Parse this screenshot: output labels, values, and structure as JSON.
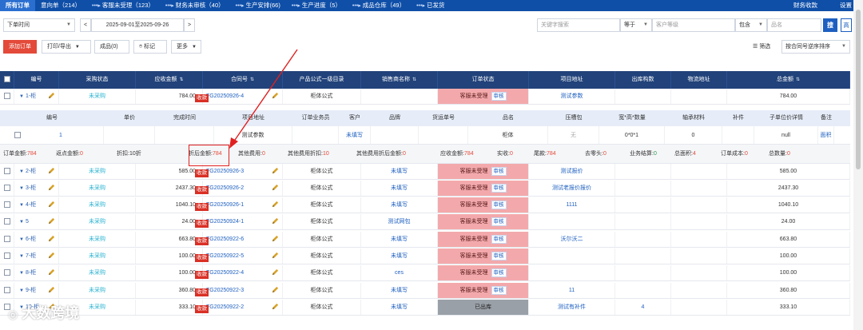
{
  "nav": {
    "tabs": [
      {
        "label": "所有订单"
      },
      {
        "label": "意向单（214）"
      },
      {
        "label": "客服未受理（123）"
      },
      {
        "label": "财务未审核（40）"
      },
      {
        "label": "生产安排(66)"
      },
      {
        "label": "生产进度（5）"
      },
      {
        "label": "成品仓库（49）"
      },
      {
        "label": "已发货"
      }
    ],
    "arrow": "•••▸",
    "right": [
      {
        "label": "财务收款"
      },
      {
        "label": "设置"
      }
    ]
  },
  "filters": {
    "date_type": "下单时间",
    "prev": "<",
    "date_range": "2025-09-01至2025-09-26",
    "next": ">",
    "keyword_placeholder": "关键字搜索",
    "operator": "等于",
    "customer_level_placeholder": "客户等级",
    "contains": "包含",
    "product_placeholder": "品名",
    "search_btn": "搜",
    "advanced_btn": "高级"
  },
  "toolbar": {
    "add_order": "添加订单",
    "print_export": "打印/导出",
    "done": "成品(0)",
    "mark": "标记",
    "more": "更多",
    "filter": "筛选",
    "sort": "按合同号逆序排序"
  },
  "table": {
    "headers": [
      "编号",
      "采购状态",
      "应收金额",
      "合同号",
      "产品公式一级目录",
      "销售商名称",
      "订单状态",
      "项目地址",
      "出库构数",
      "物流地址",
      "总金额"
    ],
    "sortable": [
      false,
      false,
      true,
      true,
      false,
      true,
      false,
      false,
      false,
      false,
      true
    ],
    "rows": [
      {
        "id": "1-柜",
        "purchase": "未采购",
        "amount": "784.00",
        "collect": "收款",
        "code": "FG20250926-4",
        "formula": "柜体公式",
        "seller": "",
        "status": "客服未受理",
        "audit": "审核",
        "address": "测试参数",
        "out": "",
        "logistic": "",
        "total": "784.00",
        "status_color": "pink"
      },
      {
        "id": "2-柜",
        "purchase": "未采购",
        "amount": "585.00",
        "collect": "收款",
        "code": "FG20250926-3",
        "formula": "柜体公式",
        "seller": "未填写",
        "status": "客服未受理",
        "audit": "审核",
        "address": "测试报价",
        "out": "",
        "logistic": "",
        "total": "585.00",
        "status_color": "pink"
      },
      {
        "id": "3-柜",
        "purchase": "未采购",
        "amount": "2437.30",
        "collect": "收款",
        "code": "FG20250926-2",
        "formula": "柜体公式",
        "seller": "未填写",
        "status": "客服未受理",
        "audit": "审核",
        "address": "测试老报价报价",
        "out": "",
        "logistic": "",
        "total": "2437.30",
        "status_color": "pink"
      },
      {
        "id": "4-柜",
        "purchase": "未采购",
        "amount": "1040.10",
        "collect": "收款",
        "code": "FG20250926-1",
        "formula": "柜体公式",
        "seller": "未填写",
        "status": "客服未受理",
        "audit": "审核",
        "address": "1111",
        "out": "",
        "logistic": "",
        "total": "1040.10",
        "status_color": "pink"
      },
      {
        "id": "5",
        "purchase": "未采购",
        "amount": "24.00",
        "collect": "收款",
        "code": "FG20250924-1",
        "formula": "柜体公式",
        "seller": "测试网包",
        "status": "客服未受理",
        "audit": "审核",
        "address": "",
        "out": "",
        "logistic": "",
        "total": "24.00",
        "status_color": "pink"
      },
      {
        "id": "6-柜",
        "purchase": "未采购",
        "amount": "663.80",
        "collect": "收款",
        "code": "FG20250922-6",
        "formula": "柜体公式",
        "seller": "未填写",
        "status": "客服未受理",
        "audit": "审核",
        "address": "沃尔沃二",
        "out": "",
        "logistic": "",
        "total": "663.80",
        "status_color": "pink"
      },
      {
        "id": "7-柜",
        "purchase": "未采购",
        "amount": "100.00",
        "collect": "收款",
        "code": "FG20250922-5",
        "formula": "柜体公式",
        "seller": "未填写",
        "status": "客服未受理",
        "audit": "审核",
        "address": "",
        "out": "",
        "logistic": "",
        "total": "100.00",
        "status_color": "pink"
      },
      {
        "id": "8-柜",
        "purchase": "未采购",
        "amount": "100.00",
        "collect": "收款",
        "code": "FG20250922-4",
        "formula": "柜体公式",
        "seller": "ces",
        "status": "客服未受理",
        "audit": "审核",
        "address": "",
        "out": "",
        "logistic": "",
        "total": "100.00",
        "status_color": "pink"
      },
      {
        "id": "9-柜",
        "purchase": "未采购",
        "amount": "360.80",
        "collect": "收款",
        "code": "FG20250922-3",
        "formula": "柜体公式",
        "seller": "未填写",
        "status": "客服未受理",
        "audit": "审核",
        "address": "11",
        "out": "",
        "logistic": "",
        "total": "360.80",
        "status_color": "pink"
      },
      {
        "id": "10-柜",
        "purchase": "未采购",
        "amount": "333.10",
        "collect": "收款",
        "code": "FG20250922-2",
        "formula": "柜体公式",
        "seller": "未填写",
        "status": "已出库",
        "audit": "",
        "address": "测试有补件",
        "out": "4",
        "logistic": "",
        "total": "333.10",
        "status_color": "gray"
      }
    ]
  },
  "subtable": {
    "headers": [
      "编号",
      "单价",
      "完成时间",
      "项目地址",
      "订单业务员",
      "客户",
      "品牌",
      "货运单号",
      "品名",
      "压槽包",
      "宽*高*数量",
      "轴承材料",
      "补件",
      "子单位价详情",
      "备注"
    ],
    "row": [
      "1",
      "",
      "",
      "测试参数",
      "",
      "未填写",
      "",
      "",
      "柜体",
      "无",
      "0*0*1",
      "0",
      "",
      "null",
      "面积"
    ]
  },
  "summary": {
    "order_amount_label": "订单金额:",
    "order_amount": "784",
    "rebate_label": "返点金额:",
    "rebate": "0",
    "discount_label": "折扣:",
    "discount": "10折",
    "discount_amount_label": "折后金额:",
    "discount_amount": "784",
    "other_fee_label": "其他费用:",
    "other_fee": "0",
    "other_discount_label": "其他费用折扣:",
    "other_discount": "10",
    "other_after_label": "其他费用折后金额:",
    "other_after": "0",
    "receivable_label": "应收金额:",
    "receivable": "784",
    "paid_label": "实收:",
    "paid": "0",
    "tail_label": "尾款:",
    "tail": "784",
    "wipe_label": "去零头:",
    "wipe": "0",
    "business_label": "业务结算:",
    "business": "0",
    "total_area_label": "总面积:",
    "total_area": "4",
    "cost_label": "订单成本:",
    "cost": "0",
    "count_label": "总数量:",
    "count": "0"
  },
  "watermark": "大数跨境",
  "colors": {
    "nav": "#0f4fa8",
    "header": "#21427a",
    "pink": "#f3a9ab",
    "red": "#e34a3a",
    "link": "#1d5fc0"
  }
}
